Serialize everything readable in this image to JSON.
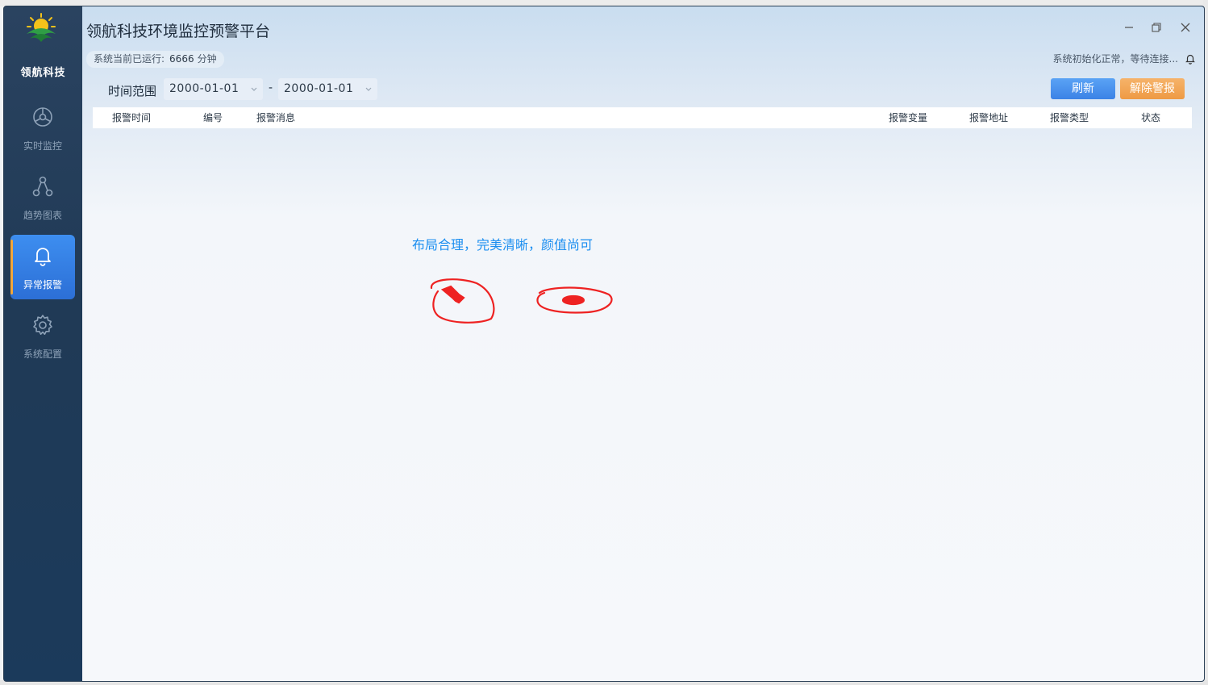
{
  "app": {
    "brand": "领航科技",
    "title": "领航科技环境监控预警平台"
  },
  "sidebar": {
    "items": [
      {
        "label": "实时监控",
        "icon": "dashboard-icon",
        "active": false
      },
      {
        "label": "趋势图表",
        "icon": "chart-nodes-icon",
        "active": false
      },
      {
        "label": "异常报警",
        "icon": "bell-icon",
        "active": true
      },
      {
        "label": "系统配置",
        "icon": "gear-icon",
        "active": false
      }
    ]
  },
  "status": {
    "runtime_label": "系统当前已运行:",
    "runtime_value": "6666",
    "runtime_unit": "分钟",
    "system_message": "系统初始化正常，等待连接..."
  },
  "toolbar": {
    "range_label": "时间范围",
    "start_date": "2000-01-01",
    "end_date": "2000-01-01",
    "separator": "-",
    "refresh_label": "刷新",
    "clear_alarm_label": "解除警报"
  },
  "table": {
    "columns": [
      "报警时间",
      "编号",
      "报警消息",
      "报警变量",
      "报警地址",
      "报警类型",
      "状态"
    ],
    "rows": []
  },
  "annotation": {
    "text": "布局合理，完美清晰，颜值尚可"
  },
  "colors": {
    "sidebar": "#203a56",
    "active_nav": "#2c6fd6",
    "active_marker": "#f3a73a",
    "refresh_button": "#3b82e6",
    "clear_button": "#ee9a44",
    "annotation_text": "#1b8ef0",
    "scribble": "#ee2222"
  }
}
